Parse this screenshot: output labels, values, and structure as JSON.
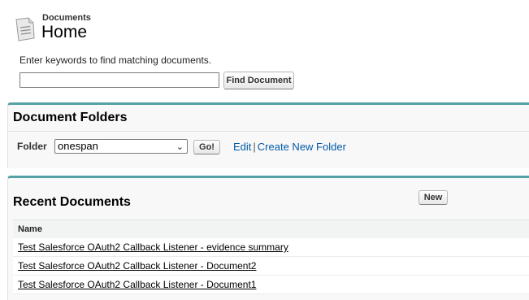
{
  "header": {
    "section_label": "Documents",
    "page_title": "Home"
  },
  "search": {
    "hint": "Enter keywords to find matching documents.",
    "value": "",
    "button_label": "Find Document"
  },
  "folders_panel": {
    "title": "Document Folders",
    "folder_label": "Folder",
    "selected_folder": "onespan",
    "go_label": "Go!",
    "edit_label": "Edit",
    "separator": "|",
    "create_label": "Create New Folder"
  },
  "recent_panel": {
    "title": "Recent Documents",
    "new_label": "New",
    "column_name": "Name",
    "rows": [
      "Test Salesforce OAuth2 Callback Listener - evidence summary",
      "Test Salesforce OAuth2 Callback Listener - Document2",
      "Test Salesforce OAuth2 Callback Listener - Document1"
    ]
  },
  "colors": {
    "accent": "#56a1a3",
    "link": "#015ba7"
  },
  "icons": {
    "header": "document-icon",
    "select": "chevron-down-icon"
  }
}
